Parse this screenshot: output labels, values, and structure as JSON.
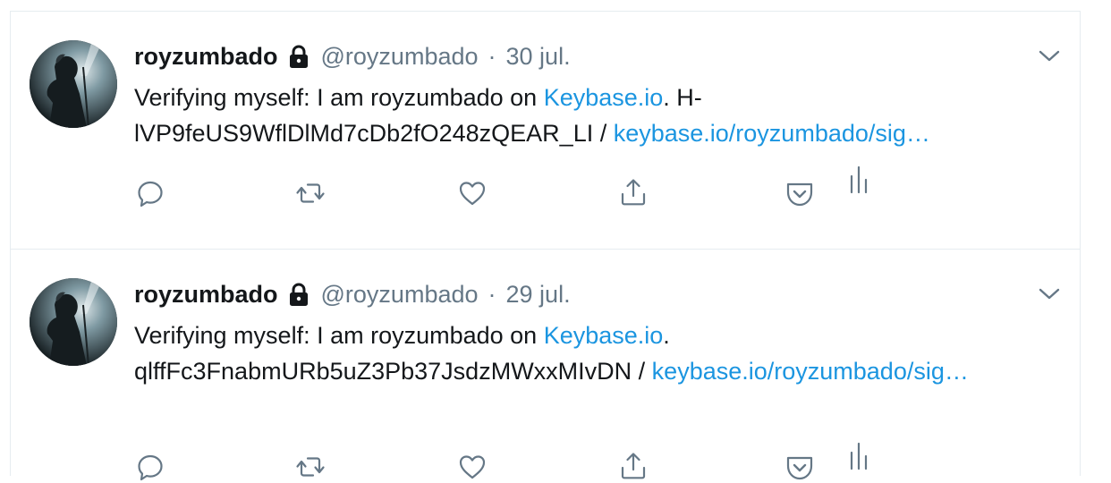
{
  "tweets": [
    {
      "name": "royzumbado",
      "handle": "@royzumbado",
      "separator": "·",
      "date": "30 jul.",
      "text_prefix": "Verifying myself: I am royzumbado on ",
      "link_keybase": "Keybase.io",
      "text_middle": ". H-lVP9feUS9WflDlMd7cDb2fO248zQEAR_LI / ",
      "link_proof": "keybase.io/royzumbado/sig…"
    },
    {
      "name": "royzumbado",
      "handle": "@royzumbado",
      "separator": "·",
      "date": "29 jul.",
      "text_prefix": "Verifying myself: I am royzumbado on ",
      "link_keybase": "Keybase.io",
      "text_middle": ". qlffFc3FnabmURb5uZ3Pb37JsdzMWxxMIvDN / ",
      "link_proof": "keybase.io/royzumbado/sig…"
    }
  ],
  "icons": {
    "reply": "reply-icon",
    "retweet": "retweet-icon",
    "like": "like-icon",
    "share": "share-icon",
    "pocket": "pocket-icon",
    "analytics": "analytics-icon",
    "lock": "lock-icon",
    "caret": "chevron-down-icon"
  },
  "colors": {
    "text": "#14171a",
    "muted": "#657786",
    "link": "#1b95e0",
    "border": "#e6ecf0",
    "icon": "#657786"
  }
}
